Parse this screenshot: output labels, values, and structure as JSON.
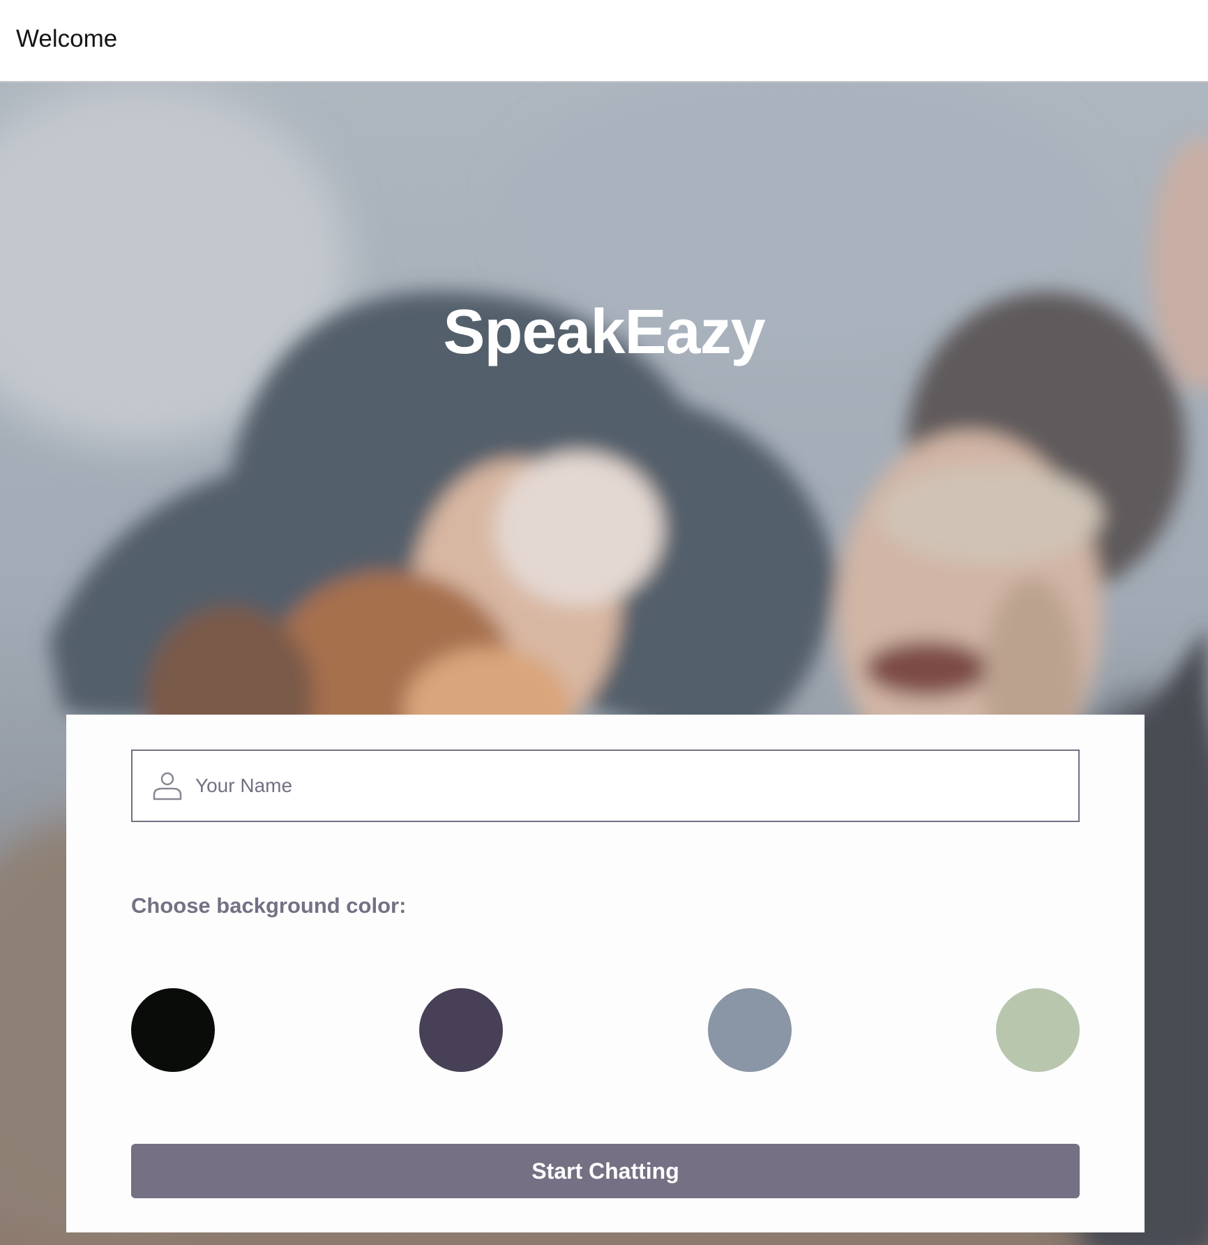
{
  "header": {
    "title": "Welcome"
  },
  "hero": {
    "app_title": "SpeakEazy"
  },
  "form": {
    "name_placeholder": "Your Name",
    "name_value": "",
    "name_icon": "person-icon",
    "color_label": "Choose background color:",
    "colors": [
      "#090C08",
      "#474056",
      "#8A95A5",
      "#B9C6AE"
    ],
    "start_label": "Start Chatting",
    "button_color": "#757083"
  }
}
